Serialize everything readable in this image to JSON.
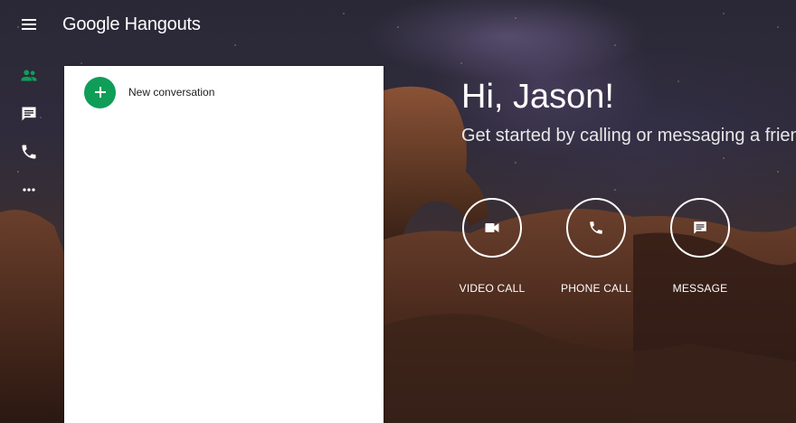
{
  "header": {
    "menu_icon": "hamburger-menu-icon",
    "brand_title": "Google Hangouts"
  },
  "sidebar": {
    "items": [
      {
        "icon": "contacts-icon",
        "color": "#0f9d58"
      },
      {
        "icon": "chat-icon",
        "color": "#ffffff"
      },
      {
        "icon": "phone-icon",
        "color": "#ffffff"
      },
      {
        "icon": "more-horiz-icon",
        "color": "#ffffff"
      }
    ]
  },
  "conversations": {
    "new_conversation_label": "New conversation",
    "fab_color": "#0f9d58"
  },
  "welcome": {
    "greeting": "Hi, Jason!",
    "subtitle": "Get started by calling or messaging a friend"
  },
  "actions": [
    {
      "label": "VIDEO CALL",
      "icon": "videocam-icon"
    },
    {
      "label": "PHONE CALL",
      "icon": "phone-icon"
    },
    {
      "label": "MESSAGE",
      "icon": "message-icon"
    }
  ]
}
